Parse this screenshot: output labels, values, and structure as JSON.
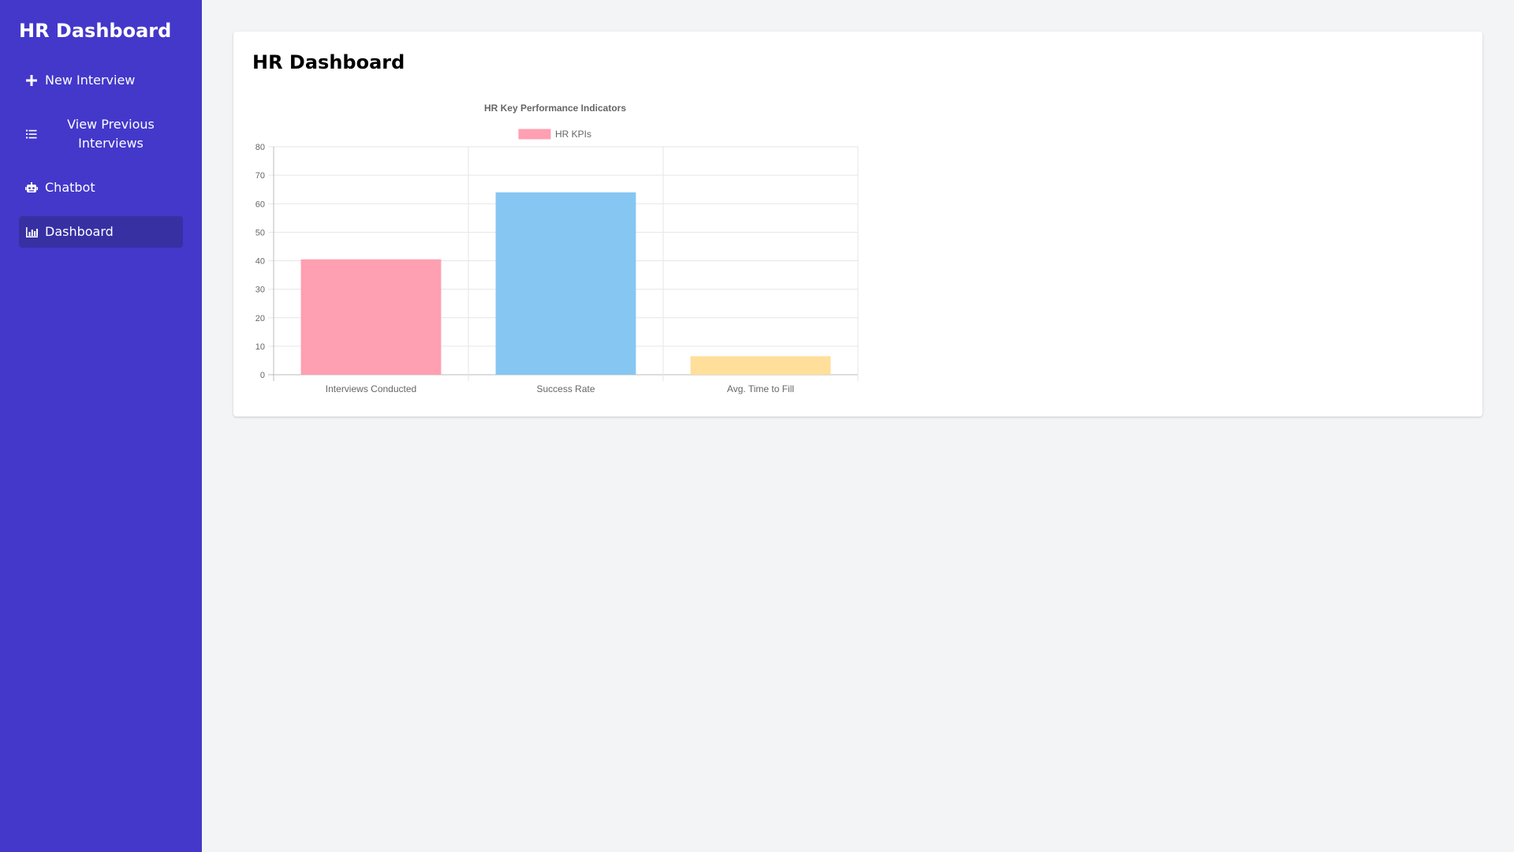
{
  "sidebar": {
    "title": "HR Dashboard",
    "items": [
      {
        "label": "New Interview",
        "icon": "plus-icon",
        "active": false
      },
      {
        "label": "View Previous Interviews",
        "icon": "list-icon",
        "active": false
      },
      {
        "label": "Chatbot",
        "icon": "robot-icon",
        "active": false
      },
      {
        "label": "Dashboard",
        "icon": "chart-bar-icon",
        "active": true
      }
    ]
  },
  "colors": {
    "sidebar_bg": "#4338ca",
    "active_item_bg": "#3730a3",
    "page_bg": "#f3f4f6"
  },
  "main": {
    "title": "HR Dashboard"
  },
  "chart_data": {
    "type": "bar",
    "title": "HR Key Performance Indicators",
    "categories": [
      "Interviews Conducted",
      "Success Rate",
      "Avg. Time to Fill"
    ],
    "series": [
      {
        "name": "HR KPIs",
        "values": [
          40.5,
          64,
          6.5
        ],
        "colors": [
          "#ff9fb2",
          "#86c6f2",
          "#ffdf9a"
        ]
      }
    ],
    "ylim": [
      0,
      80
    ],
    "yticks": [
      0,
      10,
      20,
      30,
      40,
      50,
      60,
      70,
      80
    ],
    "grid": true,
    "legend": "top-center",
    "legend_color": "#ff9fb2"
  }
}
